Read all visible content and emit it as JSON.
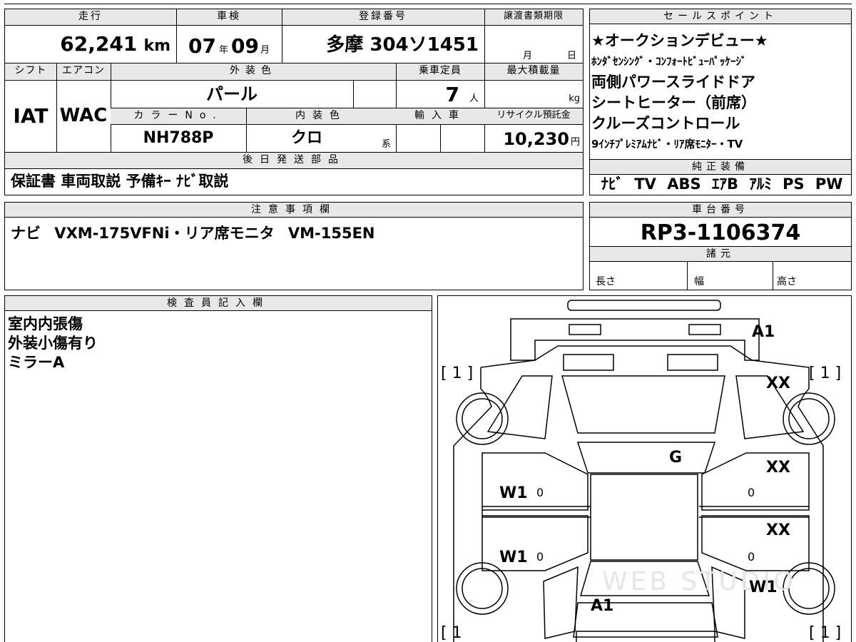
{
  "top_strip": "",
  "vehicle": {
    "mileage_label": "走行",
    "mileage_value": "62,241",
    "mileage_unit": "km",
    "inspection_label": "車検",
    "inspection_year": "07",
    "inspection_year_unit": "年",
    "inspection_month": "09",
    "inspection_month_unit": "月",
    "registration_label": "登録番号",
    "registration_value": "多摩 304ソ1451",
    "deadline_label": "譲渡書類期限",
    "deadline_month_unit": "月",
    "deadline_day_unit": "日",
    "shift_label": "シフト",
    "shift_value": "IAT",
    "aircon_label": "エアコン",
    "aircon_value": "WAC",
    "exterior_label": "外装色",
    "exterior_value": "パール",
    "capacity_label": "乗車定員",
    "capacity_value": "7",
    "capacity_unit": "人",
    "max_load_label": "最大積載量",
    "max_load_unit": "kg",
    "color_no_label": "カラーNo.",
    "color_no_value": "NH788P",
    "interior_label": "内装色",
    "interior_value": "クロ",
    "interior_unit": "系",
    "import_label": "輸入車",
    "recycle_label": "リサイクル預託金",
    "recycle_value": "10,230",
    "recycle_unit": "円",
    "later_parts_label": "後日発送部品",
    "later_parts_value": "保証書 車両取説 予備ｷｰ ﾅﾋﾞ取説"
  },
  "sales_points": {
    "label": "セールスポイント",
    "lines": [
      "★オークションデビュー★",
      "ﾎﾝﾀﾞｾﾝｼﾝｸﾞ・ｺﾝﾌｫｰﾄﾋﾞｭｰﾊﾟｯｹｰｼﾞ",
      "両側パワースライドドア",
      "シートヒーター（前席）",
      "クルーズコントロール",
      "9ｲﾝﾁﾌﾟﾚﾐｱﾑﾅﾋﾞ・ﾘｱ席ﾓﾆﾀｰ・TV"
    ]
  },
  "genuine_equipment": {
    "label": "純正装備",
    "value": "ﾅﾋﾞ TV ABS ｴｱB ｱﾙﾐ PS PW"
  },
  "notes": {
    "label": "注意事項欄",
    "value": "ナビ VXM-175VFNi・リア席モニタ VM-155EN"
  },
  "chassis": {
    "label": "車台番号",
    "value": "RP3-1106374",
    "specs_label": "諸元",
    "length_label": "長さ",
    "width_label": "幅",
    "height_label": "高さ"
  },
  "inspector": {
    "label": "検査員記入欄",
    "lines": [
      "室内内張傷",
      "外装小傷有り",
      "ミラーA"
    ]
  },
  "diagram": {
    "marks": {
      "top_right": "A1",
      "front_left_tire": "[ 1 ]",
      "front_right_tire": "[ 1 ]",
      "right_front": "XX",
      "roof": "G",
      "right_mid": "XX",
      "left_front_door": "W1",
      "left_rear_door": "W1",
      "right_lower": "XX",
      "right_rear": "W1",
      "rear_center": "A1",
      "rear_left_tire": "[ 1",
      "rear_right_tire": "[ 1 ]",
      "zero": "0"
    },
    "watermark": "WEB STUDIO"
  }
}
